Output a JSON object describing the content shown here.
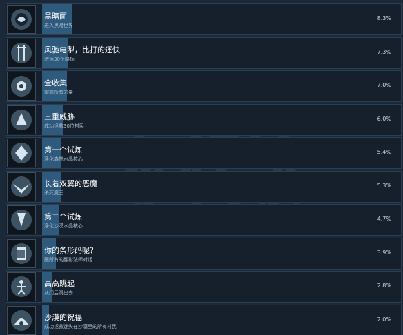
{
  "achievements": [
    {
      "title": "黑暗面",
      "desc": "进入黑暗世界",
      "pct": "8.3%",
      "icon": "dark-side-icon",
      "progress": 0.083
    },
    {
      "title": "风驰电掣，比打的还快",
      "desc": "激活30个路标",
      "pct": "7.3%",
      "icon": "signpost-icon",
      "progress": 0.073
    },
    {
      "title": "全收集",
      "desc": "掌握所有力量",
      "pct": "7.0%",
      "icon": "collection-icon",
      "progress": 0.07
    },
    {
      "title": "三重威胁",
      "desc": "成功拯救30位村民",
      "pct": "6.0%",
      "icon": "triple-threat-icon",
      "progress": 0.06
    },
    {
      "title": "第一个试炼",
      "desc": "净化森林水晶核心",
      "pct": "5.4%",
      "icon": "first-trial-icon",
      "progress": 0.054
    },
    {
      "title": "长着双翼的恶魔",
      "desc": "杀死魔王",
      "pct": "5.3%",
      "icon": "winged-demon-icon",
      "progress": 0.053
    },
    {
      "title": "第二个试炼",
      "desc": "净化沙漠水晶核心",
      "pct": "4.7%",
      "icon": "second-trial-icon",
      "progress": 0.047
    },
    {
      "title": "你的条形码呢？",
      "desc": "跟所有的翻影法师对话",
      "pct": "3.9%",
      "icon": "barcode-icon",
      "progress": 0.039
    },
    {
      "title": "高高跳起",
      "desc": "从门后跳出去",
      "pct": "2.8%",
      "icon": "high-jump-icon",
      "progress": 0.028
    },
    {
      "title": "沙漠的祝福",
      "desc": "成功拯救迷失在沙漠里的所有村民",
      "pct": "2.0%",
      "icon": "desert-blessing-icon",
      "progress": 0.02
    }
  ],
  "colors": {
    "background": "#1b2838",
    "progress_fill": "#2e5a7e",
    "title": "#ffffff",
    "description": "#a8bccb"
  }
}
